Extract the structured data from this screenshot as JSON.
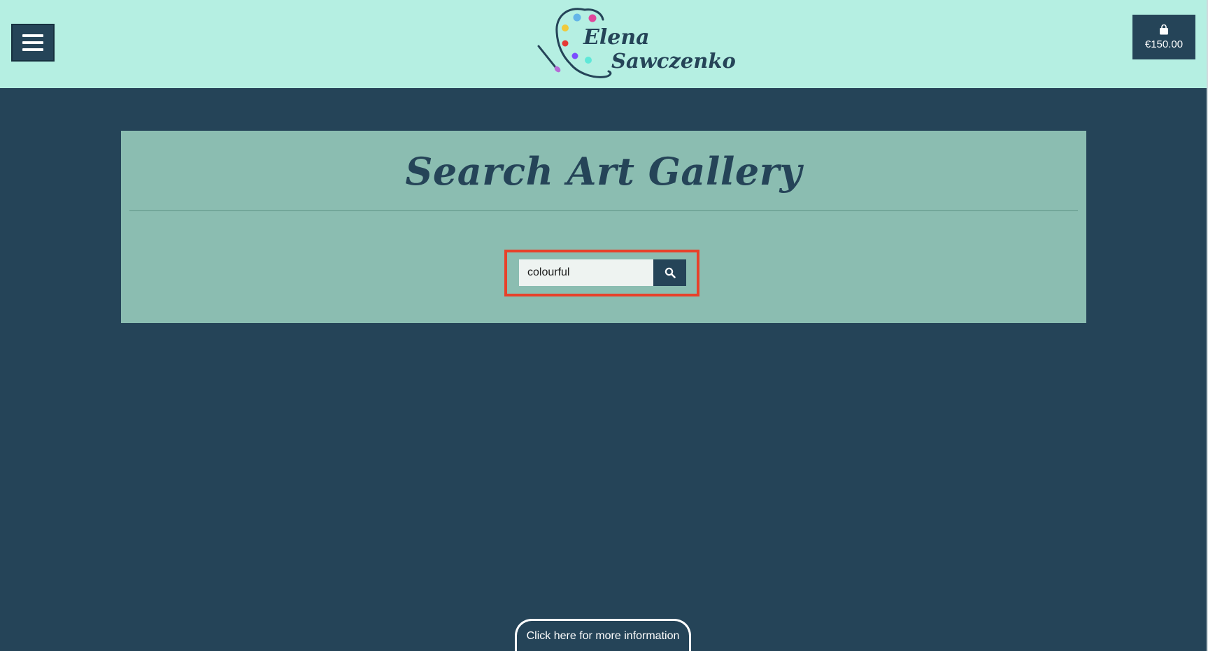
{
  "header": {
    "menu_icon": "hamburger-icon",
    "logo": {
      "line1": "Elena",
      "line2": "Sawczenko"
    },
    "cart": {
      "icon": "shopping-bag-icon",
      "amount": "€150.00"
    }
  },
  "main": {
    "title": "Search Art Gallery",
    "search": {
      "value": "colourful",
      "placeholder": "",
      "button_icon": "search-icon"
    }
  },
  "footer": {
    "info_tab_label": "Click here for more information"
  },
  "colors": {
    "header_bg": "#b5efe2",
    "page_bg": "#254458",
    "panel_bg": "#8bbdb1",
    "highlight": "#e8412a"
  }
}
